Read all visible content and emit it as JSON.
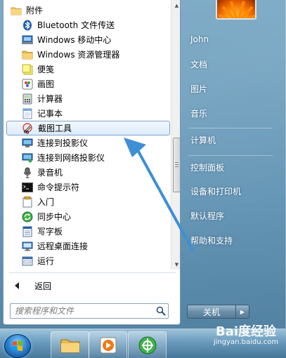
{
  "programs": [
    {
      "label": "附件",
      "icon": "folder-icon",
      "type": "folder"
    },
    {
      "label": "Bluetooth 文件传送",
      "icon": "bluetooth-icon",
      "type": "sub"
    },
    {
      "label": "Windows 移动中心",
      "icon": "mobility-center-icon",
      "type": "sub"
    },
    {
      "label": "Windows 资源管理器",
      "icon": "explorer-folder-icon",
      "type": "sub"
    },
    {
      "label": "便笺",
      "icon": "sticky-notes-icon",
      "type": "sub"
    },
    {
      "label": "画图",
      "icon": "paint-icon",
      "type": "sub"
    },
    {
      "label": "计算器",
      "icon": "calculator-icon",
      "type": "sub"
    },
    {
      "label": "记事本",
      "icon": "notepad-icon",
      "type": "sub"
    },
    {
      "label": "截图工具",
      "icon": "snipping-tool-icon",
      "type": "sub",
      "highlight": true
    },
    {
      "label": "连接到投影仪",
      "icon": "projector-icon",
      "type": "sub"
    },
    {
      "label": "连接到网络投影仪",
      "icon": "network-projector-icon",
      "type": "sub"
    },
    {
      "label": "录音机",
      "icon": "microphone-icon",
      "type": "sub"
    },
    {
      "label": "命令提示符",
      "icon": "command-prompt-icon",
      "type": "sub"
    },
    {
      "label": "入门",
      "icon": "getting-started-icon",
      "type": "sub"
    },
    {
      "label": "同步中心",
      "icon": "sync-center-icon",
      "type": "sub"
    },
    {
      "label": "写字板",
      "icon": "wordpad-icon",
      "type": "sub"
    },
    {
      "label": "远程桌面连接",
      "icon": "remote-desktop-icon",
      "type": "sub"
    },
    {
      "label": "运行",
      "icon": "run-icon",
      "type": "sub"
    }
  ],
  "back_label": "返回",
  "search_placeholder": "搜索程序和文件",
  "right_links": [
    {
      "label": "John",
      "name": "user-name-link"
    },
    {
      "label": "文档",
      "name": "documents-link"
    },
    {
      "label": "图片",
      "name": "pictures-link"
    },
    {
      "label": "音乐",
      "name": "music-link"
    },
    {
      "label": "计算机",
      "name": "computer-link"
    },
    {
      "label": "控制面板",
      "name": "control-panel-link"
    },
    {
      "label": "设备和打印机",
      "name": "devices-printers-link"
    },
    {
      "label": "默认程序",
      "name": "default-programs-link"
    },
    {
      "label": "帮助和支持",
      "name": "help-support-link"
    }
  ],
  "shutdown_label": "关机",
  "watermark": {
    "brand": "Bai度经验",
    "url": "jingyan.baidu.com"
  },
  "colors": {
    "highlight_border": "#7da2ce",
    "annotation_arrow": "#3d8fd6",
    "menu_glass": "#6a98b8"
  }
}
